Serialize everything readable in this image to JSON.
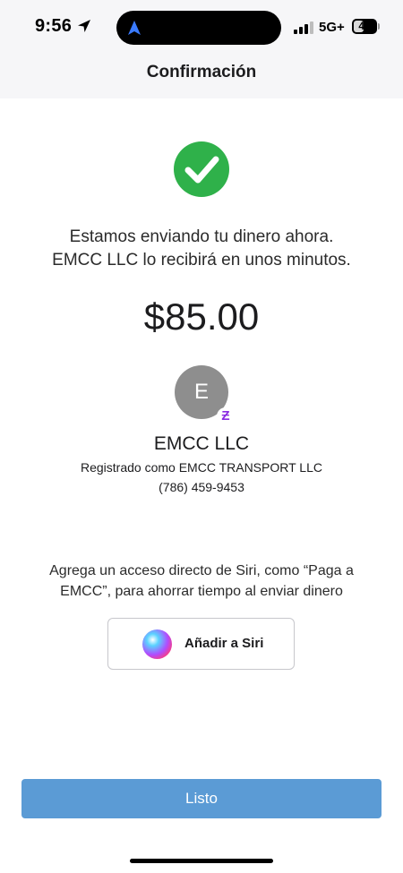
{
  "status_bar": {
    "time": "9:56",
    "network": "5G+",
    "battery_percent": "46",
    "battery_level": 0.46
  },
  "nav": {
    "title": "Confirmación"
  },
  "confirmation": {
    "message_line1": "Estamos enviando tu dinero ahora.",
    "message_line2": "EMCC LLC lo recibirá en unos minutos.",
    "amount": "$85.00"
  },
  "recipient": {
    "avatar_initial": "E",
    "badge_symbol": "Ƶ",
    "name": "EMCC LLC",
    "registered_as": "Registrado como EMCC TRANSPORT LLC",
    "phone": "(786) 459-9453"
  },
  "siri": {
    "prompt_line1": "Agrega un acceso directo de Siri, como “Paga a",
    "prompt_line2": "EMCC”, para ahorrar tiempo al enviar dinero",
    "button_label": "Añadir a Siri"
  },
  "actions": {
    "done_label": "Listo"
  },
  "colors": {
    "success": "#2fb14a",
    "primary_button": "#5b9bd5",
    "badge": "#8a2be2",
    "header_bg": "#f6f6f8"
  },
  "icons": [
    "location-arrow-icon",
    "navigation-icon",
    "signal-icon",
    "battery-icon",
    "checkmark-icon",
    "siri-icon",
    "cash-app-badge-icon"
  ]
}
